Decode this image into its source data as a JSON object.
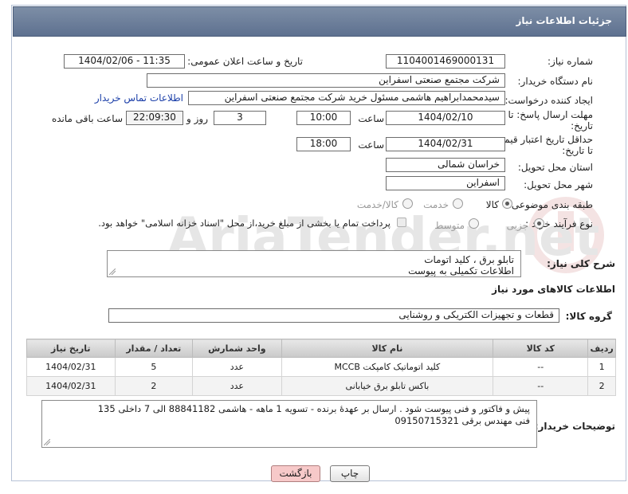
{
  "header": {
    "title": "جزئیات اطلاعات نیاز"
  },
  "fields": {
    "need_number_label": "شماره نیاز:",
    "need_number": "1104001469000131",
    "announce_label": "تاریخ و ساعت اعلان عمومی:",
    "announce_value": "1404/02/06 - 11:35",
    "buyer_label": "نام دستگاه خریدار:",
    "buyer_value": "شرکت مجتمع صنعتی اسفراین",
    "creator_label": "ایجاد کننده درخواست:",
    "creator_value": "سیدمحمدابراهیم هاشمی مسئول خرید شرکت مجتمع صنعتی اسفراین",
    "contact_link": "اطلاعات تماس خریدار",
    "deadline_label_1": "مهلت ارسال پاسخ: تا",
    "deadline_label_2": "تاریخ:",
    "deadline_date": "1404/02/10",
    "time_label": "ساعت",
    "deadline_time": "10:00",
    "days_value": "3",
    "days_label": "روز و",
    "remaining_time": "22:09:30",
    "remaining_label": "ساعت باقی مانده",
    "validity_label_1": "حداقل تاریخ اعتبار قیمت:",
    "validity_label_2": "تا تاریخ:",
    "validity_date": "1404/02/31",
    "validity_time": "18:00",
    "province_label": "استان محل تحویل:",
    "province_value": "خراسان شمالی",
    "city_label": "شهر محل تحویل:",
    "city_value": "اسفراین",
    "category_label": "طبقه بندی موضوعی:",
    "category_options": [
      "کالا",
      "خدمت",
      "کالا/خدمت"
    ],
    "process_label": "نوع فرآیند خرید :",
    "process_options": [
      "جزیی",
      "متوسط"
    ],
    "payment_note": "پرداخت تمام یا بخشی از مبلغ خرید،از محل \"اسناد خزانه اسلامی\" خواهد بود."
  },
  "description": {
    "label": "شرح کلی نیاز:",
    "line1": "تابلو برق ، کلید اتومات",
    "line2": "اطلاعات تکمیلی به پیوست"
  },
  "goods_section": {
    "title": "اطلاعات کالاهای مورد نیاز",
    "group_label": "گروه کالا:",
    "group_value": "قطعات و تجهیزات الکتریکی و روشنایی"
  },
  "table": {
    "headers": [
      "ردیف",
      "کد کالا",
      "نام کالا",
      "واحد شمارش",
      "تعداد / مقدار",
      "تاریخ نیاز"
    ],
    "rows": [
      [
        "1",
        "--",
        "کلید اتوماتیک کامپکت MCCB",
        "عدد",
        "5",
        "1404/02/31"
      ],
      [
        "2",
        "--",
        "باکس تابلو برق خیابانی",
        "عدد",
        "2",
        "1404/02/31"
      ]
    ]
  },
  "buyer_notes": {
    "label": "توضیحات خریدار:",
    "line1": "پیش و فاکتور و فنی پیوست شود . ارسال بر عهدهٔ برنده - تسویه 1 ماهه - هاشمی 88841182 الی 7 داخلی 135",
    "line2": "فنی مهندس برقی 09150715321"
  },
  "buttons": {
    "print": "چاپ",
    "back": "بازگشت"
  },
  "watermark": {
    "text": "AriaTender.net"
  },
  "colors": {
    "title_bar": "#6a7c98",
    "link": "#1a3ea8",
    "back_button": "#f7c9c9"
  }
}
